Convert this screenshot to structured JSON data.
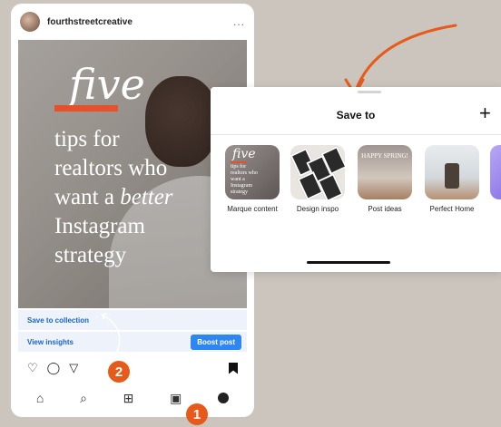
{
  "post": {
    "username": "fourthstreetcreative",
    "more": "...",
    "image_text": {
      "script_word": "five",
      "line1": "tips for",
      "line2": "realtors who",
      "line3_start": "want a ",
      "line3_emph": "better",
      "line4": "Instagram",
      "line5": "strategy"
    },
    "save_to_collection": "Save to collection",
    "view_insights": "View insights",
    "boost_post": "Boost post"
  },
  "tab_icons": [
    "home-icon",
    "search-icon",
    "create-icon",
    "reels-icon",
    "profile-icon"
  ],
  "badges": {
    "one": "1",
    "two": "2"
  },
  "sheet": {
    "title": "Save to",
    "add": "+",
    "collections": [
      {
        "label": "Marque content"
      },
      {
        "label": "Design inspo"
      },
      {
        "label": "Post ideas"
      },
      {
        "label": "Perfect Home"
      },
      {
        "label": ""
      }
    ],
    "post_ideas_thumb_text": "HAPPY SPRING!"
  },
  "colors": {
    "accent": "#e65a1a",
    "link": "#1a63c7",
    "boost": "#2e86f0"
  }
}
